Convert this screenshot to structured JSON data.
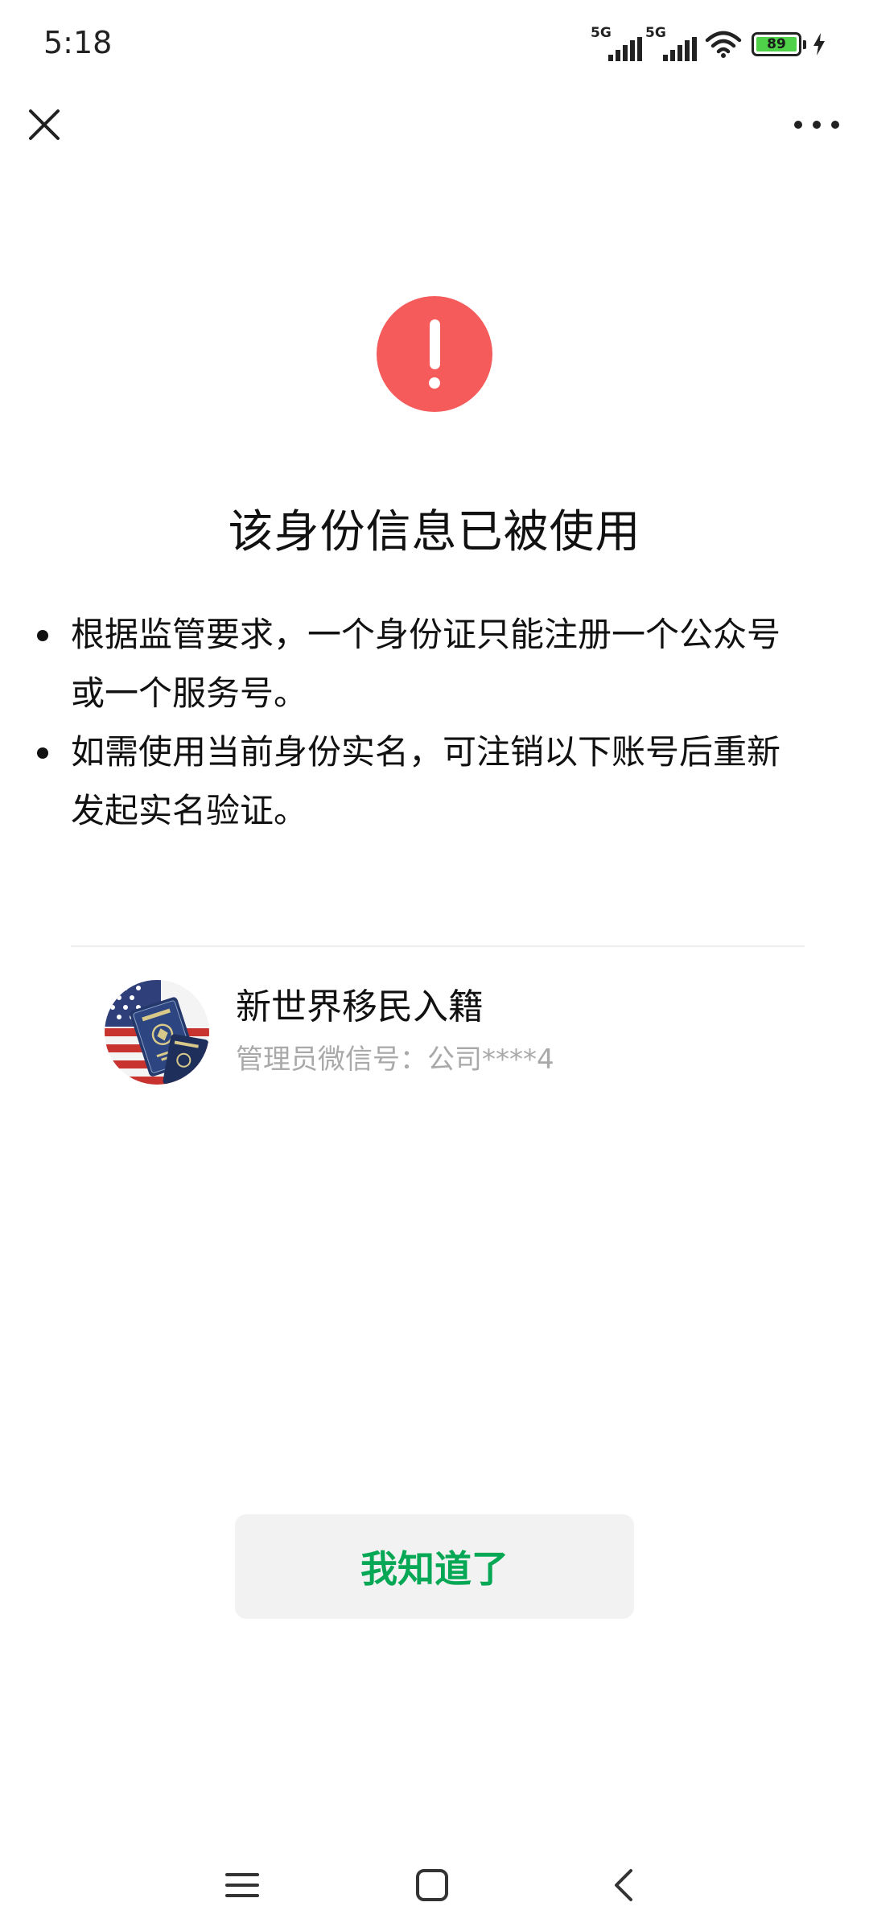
{
  "status_bar": {
    "time": "5:18",
    "network_1": "5G",
    "network_2": "5G",
    "battery_level": "89",
    "battery_color": "#4fd14a"
  },
  "nav": {
    "close_icon": "close-icon",
    "more_icon": "more-dots-icon"
  },
  "alert": {
    "icon": "exclamation-circle-icon",
    "icon_color": "#f65b5c",
    "title": "该身份信息已被使用",
    "notices": [
      "根据监管要求，一个身份证只能注册一个公众号或一个服务号。",
      "如需使用当前身份实名，可注销以下账号后重新发起实名验证。"
    ]
  },
  "account": {
    "avatar": "passport-flag-avatar",
    "name": "新世界移民入籍",
    "admin": "管理员微信号：公司****4"
  },
  "button": {
    "label": "我知道了",
    "label_color": "#07a855"
  },
  "system_nav": {
    "menu_icon": "menu-icon",
    "home_icon": "home-square-icon",
    "back_icon": "back-chevron-icon"
  }
}
